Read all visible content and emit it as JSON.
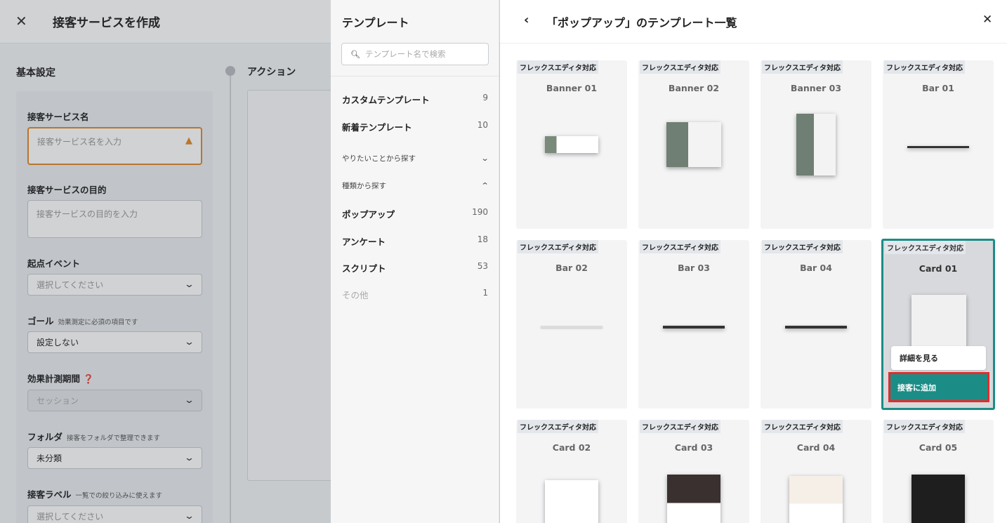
{
  "background_editor": {
    "close_icon": "close-icon",
    "title": "接客サービスを作成",
    "basic_heading": "基本設定",
    "action_heading": "アクション",
    "fields": {
      "name_label": "接客サービス名",
      "name_placeholder": "接客サービス名を入力",
      "purpose_label": "接客サービスの目的",
      "purpose_placeholder": "接客サービスの目的を入力",
      "event_label": "起点イベント",
      "event_value": "選択してください",
      "goal_label": "ゴール",
      "goal_note": "効果測定に必須の項目です",
      "goal_value": "設定しない",
      "period_label": "効果計測期間",
      "period_value": "セッション",
      "folder_label": "フォルダ",
      "folder_note": "接客をフォルダで整理できます",
      "folder_value": "未分類",
      "tag_label": "接客ラベル",
      "tag_note": "一覧での絞り込みに使えます",
      "tag_value": "選択してください"
    }
  },
  "sidebar": {
    "title": "テンプレート",
    "search_placeholder": "テンプレート名で検索",
    "top_items": [
      {
        "label": "カスタムテンプレート",
        "count": "9"
      },
      {
        "label": "新着テンプレート",
        "count": "10"
      }
    ],
    "section_goal": "やりたいことから探す",
    "section_type": "種類から探す",
    "type_items": [
      {
        "label": "ポップアップ",
        "count": "190"
      },
      {
        "label": "アンケート",
        "count": "18"
      },
      {
        "label": "スクリプト",
        "count": "53"
      },
      {
        "label": "その他",
        "count": "1"
      }
    ]
  },
  "main": {
    "title": "「ポップアップ」のテンプレート一覧",
    "tag": "フレックスエディタ対応",
    "cards": [
      {
        "name": "Banner 01"
      },
      {
        "name": "Banner 02"
      },
      {
        "name": "Banner 03"
      },
      {
        "name": "Bar 01"
      },
      {
        "name": "Bar 02"
      },
      {
        "name": "Bar 03"
      },
      {
        "name": "Bar 04"
      },
      {
        "name": "Card 01"
      },
      {
        "name": "Card 02"
      },
      {
        "name": "Card 03"
      },
      {
        "name": "Card 04"
      },
      {
        "name": "Card 05"
      }
    ],
    "hover_actions": {
      "detail": "詳細を見る",
      "add": "接客に追加"
    }
  },
  "colors": {
    "accent": "#1b8d86",
    "highlight": "#e62a2a",
    "warning": "#e0892a"
  }
}
